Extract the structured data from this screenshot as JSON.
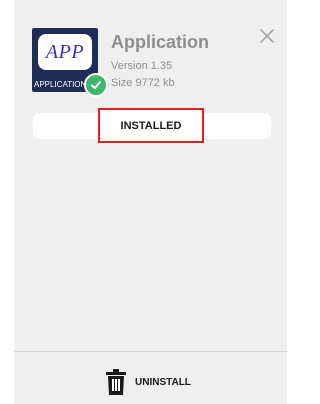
{
  "app": {
    "icon_text": "APP",
    "icon_caption": "APPLICATION",
    "name": "Application",
    "version": "Version 1.35",
    "size": "Size 9772 kb"
  },
  "status": {
    "installed_label": "INSTALLED"
  },
  "actions": {
    "uninstall_label": "UNINSTALL",
    "close_icon": "close-icon",
    "trash_icon": "trash-icon",
    "check_icon": "check-icon"
  },
  "colors": {
    "panel": "#efefef",
    "highlight": "#e0201f",
    "check": "#40b86a"
  }
}
